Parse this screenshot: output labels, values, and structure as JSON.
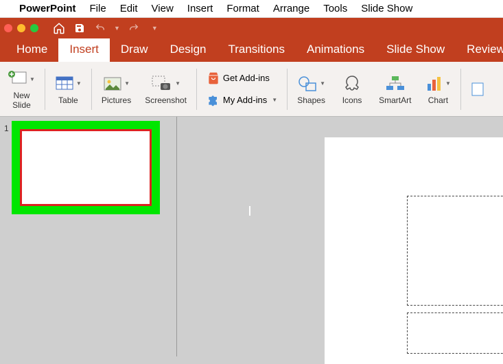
{
  "menubar": {
    "apple": "",
    "appname": "PowerPoint",
    "items": [
      "File",
      "Edit",
      "View",
      "Insert",
      "Format",
      "Arrange",
      "Tools",
      "Slide Show"
    ]
  },
  "tabs": {
    "items": [
      "Home",
      "Insert",
      "Draw",
      "Design",
      "Transitions",
      "Animations",
      "Slide Show",
      "Review"
    ],
    "active": "Insert"
  },
  "ribbon": {
    "new_slide": "New\nSlide",
    "table": "Table",
    "pictures": "Pictures",
    "screenshot": "Screenshot",
    "get_addins": "Get Add-ins",
    "my_addins": "My Add-ins",
    "shapes": "Shapes",
    "icons": "Icons",
    "smartart": "SmartArt",
    "chart": "Chart"
  },
  "slide": {
    "number": "1"
  }
}
